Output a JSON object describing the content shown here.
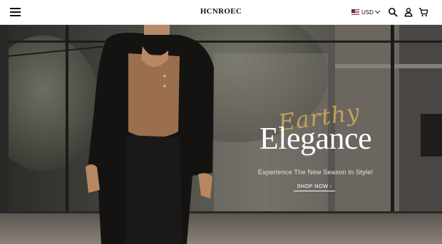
{
  "header": {
    "logo": "HCNROEC",
    "currency": "USD",
    "icons": [
      "menu-icon",
      "flag-us-icon",
      "chevron-down-icon",
      "search-icon",
      "account-icon",
      "cart-icon"
    ]
  },
  "hero": {
    "script_word": "Earthy",
    "headline": "Elegance",
    "subline": "Experience The New Season In Style!",
    "cta": "SHOP NOW ›"
  },
  "colors": {
    "accent": "#c8a55a",
    "text": "#111111"
  }
}
